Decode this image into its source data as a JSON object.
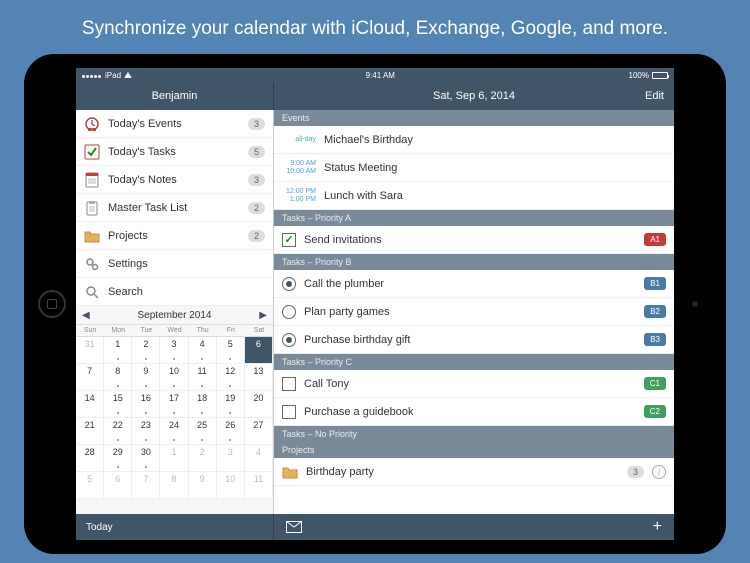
{
  "tagline": "Synchronize your calendar with iCloud, Exchange, Google, and more.",
  "statusbar": {
    "carrier": "iPad",
    "time": "9:41 AM",
    "battery_pct": "100%"
  },
  "nav": {
    "left_title": "Benjamin",
    "right_title": "Sat, Sep 6, 2014",
    "edit": "Edit"
  },
  "sidebar": {
    "items": [
      {
        "label": "Today's Events",
        "count": "3",
        "icon": "clock"
      },
      {
        "label": "Today's Tasks",
        "count": "5",
        "icon": "check"
      },
      {
        "label": "Today's Notes",
        "count": "3",
        "icon": "note"
      },
      {
        "label": "Master Task List",
        "count": "2",
        "icon": "clipboard"
      },
      {
        "label": "Projects",
        "count": "2",
        "icon": "folder"
      },
      {
        "label": "Settings",
        "count": "",
        "icon": "gears"
      },
      {
        "label": "Search",
        "count": "",
        "icon": "search"
      }
    ]
  },
  "calendar": {
    "title": "September 2014",
    "dow": [
      "Sun",
      "Mon",
      "Tue",
      "Wed",
      "Thu",
      "Fri",
      "Sat"
    ],
    "weeks": [
      [
        {
          "d": "31",
          "o": 1
        },
        {
          "d": "1",
          "dot": 1
        },
        {
          "d": "2",
          "dot": 1
        },
        {
          "d": "3",
          "dot": 1
        },
        {
          "d": "4",
          "dot": 1
        },
        {
          "d": "5",
          "dot": 1
        },
        {
          "d": "6",
          "sel": 1
        }
      ],
      [
        {
          "d": "7"
        },
        {
          "d": "8",
          "dot": 1
        },
        {
          "d": "9",
          "dot": 1
        },
        {
          "d": "10",
          "dot": 1
        },
        {
          "d": "11",
          "dot": 1
        },
        {
          "d": "12",
          "dot": 1
        },
        {
          "d": "13"
        }
      ],
      [
        {
          "d": "14"
        },
        {
          "d": "15",
          "dot": 1
        },
        {
          "d": "16",
          "dot": 1
        },
        {
          "d": "17",
          "dot": 1
        },
        {
          "d": "18",
          "dot": 1
        },
        {
          "d": "19",
          "dot": 1
        },
        {
          "d": "20"
        }
      ],
      [
        {
          "d": "21"
        },
        {
          "d": "22",
          "dot": 1
        },
        {
          "d": "23",
          "dot": 1
        },
        {
          "d": "24",
          "dot": 1
        },
        {
          "d": "25",
          "dot": 1
        },
        {
          "d": "26",
          "dot": 1
        },
        {
          "d": "27"
        }
      ],
      [
        {
          "d": "28"
        },
        {
          "d": "29",
          "dot": 1
        },
        {
          "d": "30",
          "dot": 1
        },
        {
          "d": "1",
          "o": 1
        },
        {
          "d": "2",
          "o": 1
        },
        {
          "d": "3",
          "o": 1
        },
        {
          "d": "4",
          "o": 1
        }
      ],
      [
        {
          "d": "5",
          "o": 1
        },
        {
          "d": "6",
          "o": 1
        },
        {
          "d": "7",
          "o": 1
        },
        {
          "d": "8",
          "o": 1
        },
        {
          "d": "9",
          "o": 1
        },
        {
          "d": "10",
          "o": 1
        },
        {
          "d": "11",
          "o": 1
        }
      ]
    ]
  },
  "sections": {
    "events": {
      "header": "Events",
      "items": [
        {
          "time1": "all-day",
          "time2": "",
          "title": "Michael's Birthday"
        },
        {
          "time1": "9:00 AM",
          "time2": "10:00 AM",
          "title": "Status Meeting"
        },
        {
          "time1": "12:00 PM",
          "time2": "1:00 PM",
          "title": "Lunch with Sara"
        }
      ]
    },
    "pa": {
      "header": "Tasks – Priority A",
      "items": [
        {
          "title": "Send invitations",
          "badge": "A1",
          "checked": true
        }
      ]
    },
    "pb": {
      "header": "Tasks – Priority B",
      "items": [
        {
          "title": "Call the plumber",
          "badge": "B1",
          "radio": "filled"
        },
        {
          "title": "Plan party games",
          "badge": "B2",
          "radio": "empty"
        },
        {
          "title": "Purchase birthday gift",
          "badge": "B3",
          "radio": "filled"
        }
      ]
    },
    "pc": {
      "header": "Tasks – Priority C",
      "items": [
        {
          "title": "Call Tony",
          "badge": "C1"
        },
        {
          "title": "Purchase a guidebook",
          "badge": "C2"
        }
      ]
    },
    "np": {
      "header": "Tasks – No Priority"
    },
    "proj": {
      "header": "Projects",
      "items": [
        {
          "title": "Birthday party",
          "count": "3"
        }
      ]
    }
  },
  "toolbar": {
    "today": "Today"
  }
}
